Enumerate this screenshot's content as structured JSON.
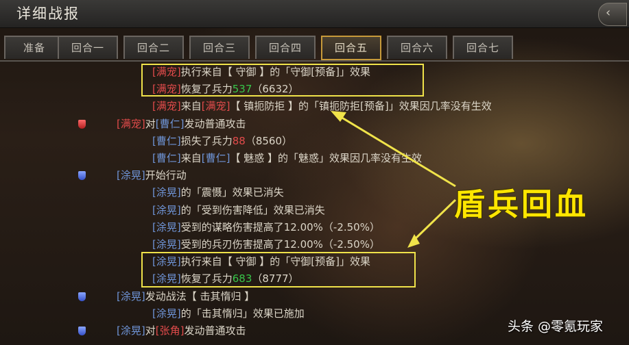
{
  "window": {
    "title": "详细战报",
    "close_icon": "‹"
  },
  "tabs": [
    {
      "label": "准备",
      "active": false
    },
    {
      "label": "回合一",
      "active": false
    },
    {
      "label": "回合二",
      "active": false
    },
    {
      "label": "回合三",
      "active": false
    },
    {
      "label": "回合四",
      "active": false
    },
    {
      "label": "回合五",
      "active": true
    },
    {
      "label": "回合六",
      "active": false
    },
    {
      "label": "回合七",
      "active": false
    }
  ],
  "log": [
    {
      "badge": null,
      "segments": [
        {
          "t": "[满宠]",
          "c": "red"
        },
        {
          "t": "执行来自【 守御 】的「守御[预备]」效果",
          "c": "txt"
        }
      ]
    },
    {
      "badge": null,
      "segments": [
        {
          "t": "[满宠]",
          "c": "red"
        },
        {
          "t": "恢复了兵力",
          "c": "txt"
        },
        {
          "t": "537",
          "c": "green"
        },
        {
          "t": "（6632）",
          "c": "txt"
        }
      ]
    },
    {
      "badge": null,
      "segments": [
        {
          "t": "[满宠]",
          "c": "red"
        },
        {
          "t": "来自",
          "c": "txt"
        },
        {
          "t": "[满宠]",
          "c": "red"
        },
        {
          "t": "【 镇扼防拒 】的「镇扼防拒[预备]」效果因几率没有生效",
          "c": "txt"
        }
      ]
    },
    {
      "badge": "red",
      "segments": [
        {
          "t": "[满宠]",
          "c": "red"
        },
        {
          "t": "对",
          "c": "txt"
        },
        {
          "t": "[曹仁]",
          "c": "blue"
        },
        {
          "t": "发动普通攻击",
          "c": "txt"
        }
      ]
    },
    {
      "badge": null,
      "segments": [
        {
          "t": "[曹仁]",
          "c": "blue"
        },
        {
          "t": "损失了兵力",
          "c": "txt"
        },
        {
          "t": "88",
          "c": "red"
        },
        {
          "t": "（8560）",
          "c": "txt"
        }
      ]
    },
    {
      "badge": null,
      "segments": [
        {
          "t": "[曹仁]",
          "c": "blue"
        },
        {
          "t": "来自",
          "c": "txt"
        },
        {
          "t": "[曹仁]",
          "c": "blue"
        },
        {
          "t": "【 魅惑 】的「魅惑」效果因几率没有生效",
          "c": "txt"
        }
      ]
    },
    {
      "badge": "blue",
      "segments": [
        {
          "t": "[涂晃]",
          "c": "blue"
        },
        {
          "t": "开始行动",
          "c": "txt"
        }
      ]
    },
    {
      "badge": null,
      "segments": [
        {
          "t": "[涂晃]",
          "c": "blue"
        },
        {
          "t": "的「震慑」效果已消失",
          "c": "txt"
        }
      ]
    },
    {
      "badge": null,
      "segments": [
        {
          "t": "[涂晃]",
          "c": "blue"
        },
        {
          "t": "的「受到伤害降低」效果已消失",
          "c": "txt"
        }
      ]
    },
    {
      "badge": null,
      "segments": [
        {
          "t": "[涂晃]",
          "c": "blue"
        },
        {
          "t": "受到的谋略伤害提高了12.00%（-2.50%）",
          "c": "txt"
        }
      ]
    },
    {
      "badge": null,
      "segments": [
        {
          "t": "[涂晃]",
          "c": "blue"
        },
        {
          "t": "受到的兵刃伤害提高了12.00%（-2.50%）",
          "c": "txt"
        }
      ]
    },
    {
      "badge": null,
      "segments": [
        {
          "t": "[涂晃]",
          "c": "blue"
        },
        {
          "t": "执行来自【 守御 】的「守御[预备]」效果",
          "c": "txt"
        }
      ]
    },
    {
      "badge": null,
      "segments": [
        {
          "t": "[涂晃]",
          "c": "blue"
        },
        {
          "t": "恢复了兵力",
          "c": "txt"
        },
        {
          "t": "683",
          "c": "green"
        },
        {
          "t": "（8777）",
          "c": "txt"
        }
      ]
    },
    {
      "badge": "blue",
      "segments": [
        {
          "t": "[涂晃]",
          "c": "blue"
        },
        {
          "t": "发动战法【 击其惰归 】",
          "c": "txt"
        }
      ]
    },
    {
      "badge": null,
      "segments": [
        {
          "t": "[涂晃]",
          "c": "blue"
        },
        {
          "t": "的「击其惰归」效果已施加",
          "c": "txt"
        }
      ]
    },
    {
      "badge": "blue",
      "segments": [
        {
          "t": "[涂晃]",
          "c": "blue"
        },
        {
          "t": "对",
          "c": "txt"
        },
        {
          "t": "[张角]",
          "c": "red"
        },
        {
          "t": "发动普通攻击",
          "c": "txt"
        }
      ]
    }
  ],
  "annotation": {
    "label": "盾兵回血",
    "color": "#ffe600"
  },
  "watermark": "头条 @零氪玩家",
  "colors": {
    "red": "#e24b4b",
    "blue": "#6f95d8",
    "green": "#38c64a",
    "highlight": "#f0e34a"
  }
}
